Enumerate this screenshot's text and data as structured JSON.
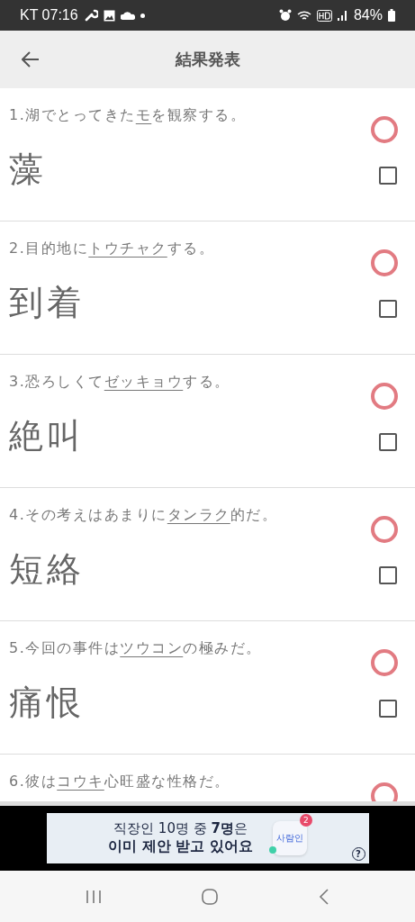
{
  "status_bar": {
    "carrier_time": "KT 07:16",
    "battery": "84%"
  },
  "header": {
    "title": "結果発表"
  },
  "questions": [
    {
      "prefix": "1.湖でとってきた",
      "target": "モ",
      "suffix": "を観察する。",
      "answer": "藻",
      "kind": "correct",
      "checked": false
    },
    {
      "prefix": "2.目的地に",
      "target": "トウチャク",
      "suffix": "する。",
      "answer": "到着",
      "kind": "correct",
      "checked": false
    },
    {
      "prefix": "3.恐ろしくて",
      "target": "ゼッキョウ",
      "suffix": "する。",
      "answer": "絶叫",
      "kind": "correct",
      "checked": false
    },
    {
      "prefix": "4.その考えはあまりに",
      "target": "タンラク",
      "suffix": "的だ。",
      "answer": "短絡",
      "kind": "correct",
      "checked": false
    },
    {
      "prefix": "5.今回の事件は",
      "target": "ツウコン",
      "suffix": "の極みだ。",
      "answer": "痛恨",
      "kind": "correct",
      "checked": false
    },
    {
      "prefix": "6.彼は",
      "target": "コウキ",
      "suffix": "心旺盛な性格だ。",
      "kind": "correct"
    }
  ],
  "ad": {
    "line_1": "직장인 10명 중 **7명**은",
    "line_2": "이미 제안 받고 있어요",
    "app_label": "사람인",
    "badge": "2",
    "help": "?"
  }
}
